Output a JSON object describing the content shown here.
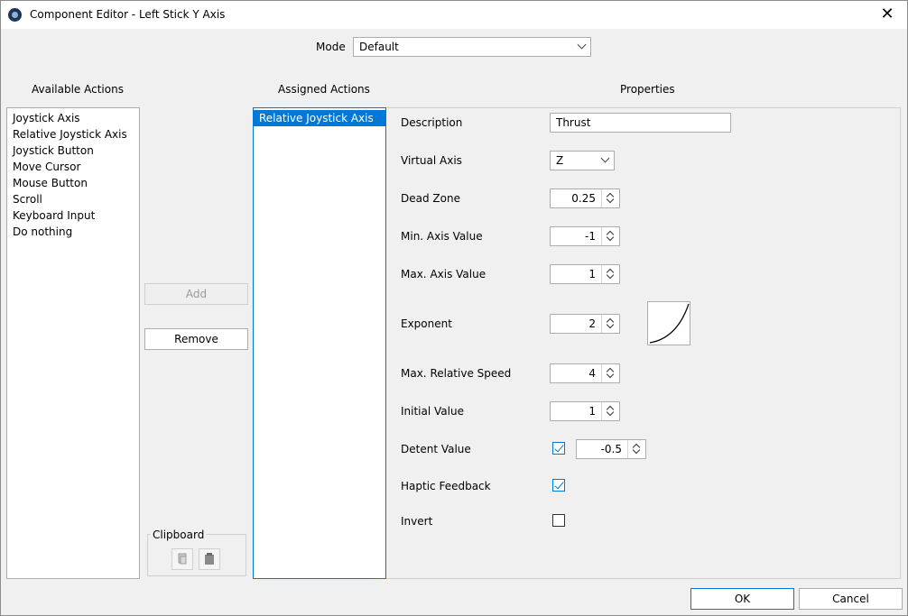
{
  "window": {
    "title": "Component Editor - Left Stick Y Axis",
    "icon": "app-logo-icon",
    "close_glyph": "✕"
  },
  "mode": {
    "label": "Mode",
    "value": "Default"
  },
  "available_actions": {
    "header": "Available Actions",
    "items": [
      "Joystick Axis",
      "Relative Joystick Axis",
      "Joystick Button",
      "Move Cursor",
      "Mouse Button",
      "Scroll",
      "Keyboard Input",
      "Do nothing"
    ]
  },
  "buttons": {
    "add": "Add",
    "remove": "Remove",
    "ok": "OK",
    "cancel": "Cancel"
  },
  "clipboard": {
    "label": "Clipboard",
    "copy_icon": "copy-icon",
    "paste_icon": "paste-icon"
  },
  "assigned_actions": {
    "header": "Assigned Actions",
    "items": [
      "Relative Joystick Axis"
    ],
    "selected_index": 0
  },
  "properties": {
    "header": "Properties",
    "description": {
      "label": "Description",
      "value": "Thrust"
    },
    "virtual_axis": {
      "label": "Virtual Axis",
      "value": "Z"
    },
    "dead_zone": {
      "label": "Dead Zone",
      "value": "0.25"
    },
    "min_axis_value": {
      "label": "Min. Axis Value",
      "value": "-1"
    },
    "max_axis_value": {
      "label": "Max. Axis Value",
      "value": "1"
    },
    "exponent": {
      "label": "Exponent",
      "value": "2"
    },
    "max_relative_speed": {
      "label": "Max. Relative Speed",
      "value": "4"
    },
    "initial_value": {
      "label": "Initial Value",
      "value": "1"
    },
    "detent_value": {
      "label": "Detent Value",
      "checked": true,
      "value": "-0.5"
    },
    "haptic_feedback": {
      "label": "Haptic Feedback",
      "checked": true
    },
    "invert": {
      "label": "Invert",
      "checked": false
    }
  },
  "colors": {
    "accent": "#0078d7",
    "background": "#f0f0f0"
  }
}
